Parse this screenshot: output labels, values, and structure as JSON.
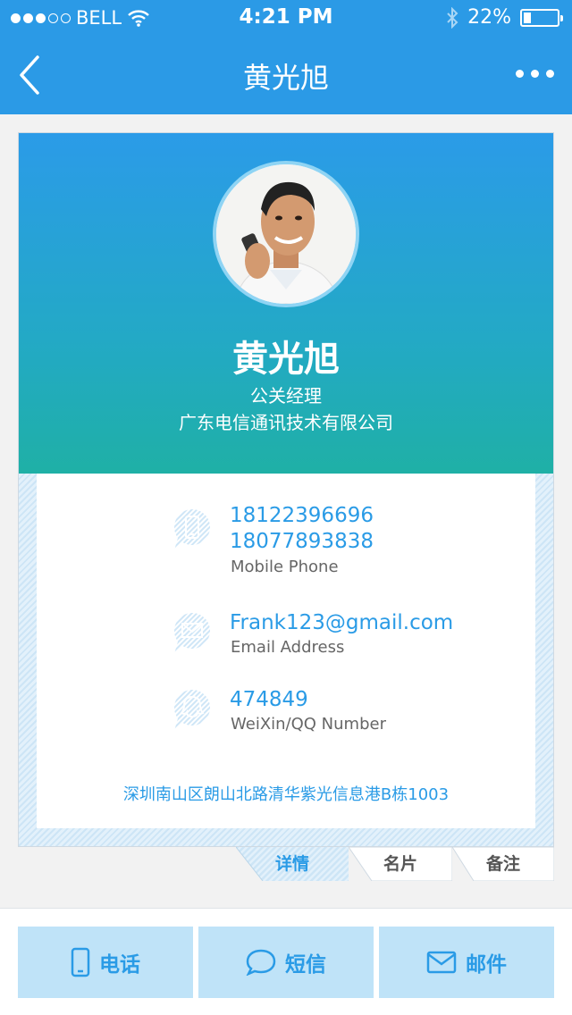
{
  "status_bar": {
    "carrier": "BELL",
    "time": "4:21 PM",
    "battery": "22%",
    "battery_level": 0.22
  },
  "nav": {
    "title": "黄光旭"
  },
  "contact": {
    "name": "黄光旭",
    "position": "公关经理",
    "company": "广东电信通讯技术有限公司",
    "phones": [
      "18122396696",
      "18077893838"
    ],
    "phone_label": "Mobile Phone",
    "email": "Frank123@gmail.com",
    "email_label": "Email Address",
    "weixin": "474849",
    "weixin_label": "WeiXin/QQ Number",
    "address": "深圳南山区朗山北路清华紫光信息港B栋1003"
  },
  "tabs": [
    {
      "label": "详情",
      "active": true
    },
    {
      "label": "名片",
      "active": false
    },
    {
      "label": "备注",
      "active": false
    }
  ],
  "actions": {
    "call": "电话",
    "sms": "短信",
    "mail": "邮件"
  },
  "colors": {
    "primary": "#2b9ae6",
    "teal": "#1fb0a6",
    "button_bg": "#bfe3f8"
  },
  "icons": [
    "back-arrow-icon",
    "more-icon",
    "wifi-icon",
    "bluetooth-icon",
    "mobile-phone-icon",
    "email-icon",
    "qq-icon",
    "chat-bubble-icon",
    "envelope-icon"
  ]
}
